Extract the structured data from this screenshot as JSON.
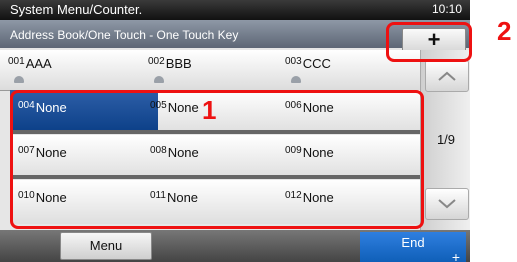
{
  "system_bar": {
    "title": "System Menu/Counter.",
    "clock": "10:10"
  },
  "title_bar": {
    "title": "Address Book/One Touch - One Touch Key"
  },
  "add_button": {
    "icon": "plus-icon",
    "label": "+"
  },
  "keys": [
    {
      "num": "001",
      "name": "AAA",
      "selected": false
    },
    {
      "num": "002",
      "name": "BBB",
      "selected": false
    },
    {
      "num": "003",
      "name": "CCC",
      "selected": false
    },
    {
      "num": "004",
      "name": "None",
      "selected": true
    },
    {
      "num": "005",
      "name": "None",
      "selected": false
    },
    {
      "num": "006",
      "name": "None",
      "selected": false
    },
    {
      "num": "007",
      "name": "None",
      "selected": false
    },
    {
      "num": "008",
      "name": "None",
      "selected": false
    },
    {
      "num": "009",
      "name": "None",
      "selected": false
    },
    {
      "num": "010",
      "name": "None",
      "selected": false
    },
    {
      "num": "011",
      "name": "None",
      "selected": false
    },
    {
      "num": "012",
      "name": "None",
      "selected": false
    }
  ],
  "pager": {
    "text": "1/9",
    "up_icon": "chevron-up-icon",
    "down_icon": "chevron-down-icon"
  },
  "bottom": {
    "menu_label": "Menu",
    "end_label": "End"
  },
  "callouts": {
    "one": "1",
    "two": "2"
  },
  "colors": {
    "selected": "#0a3e86",
    "callout": "#e11111",
    "end_button": "#1a6fd0"
  }
}
